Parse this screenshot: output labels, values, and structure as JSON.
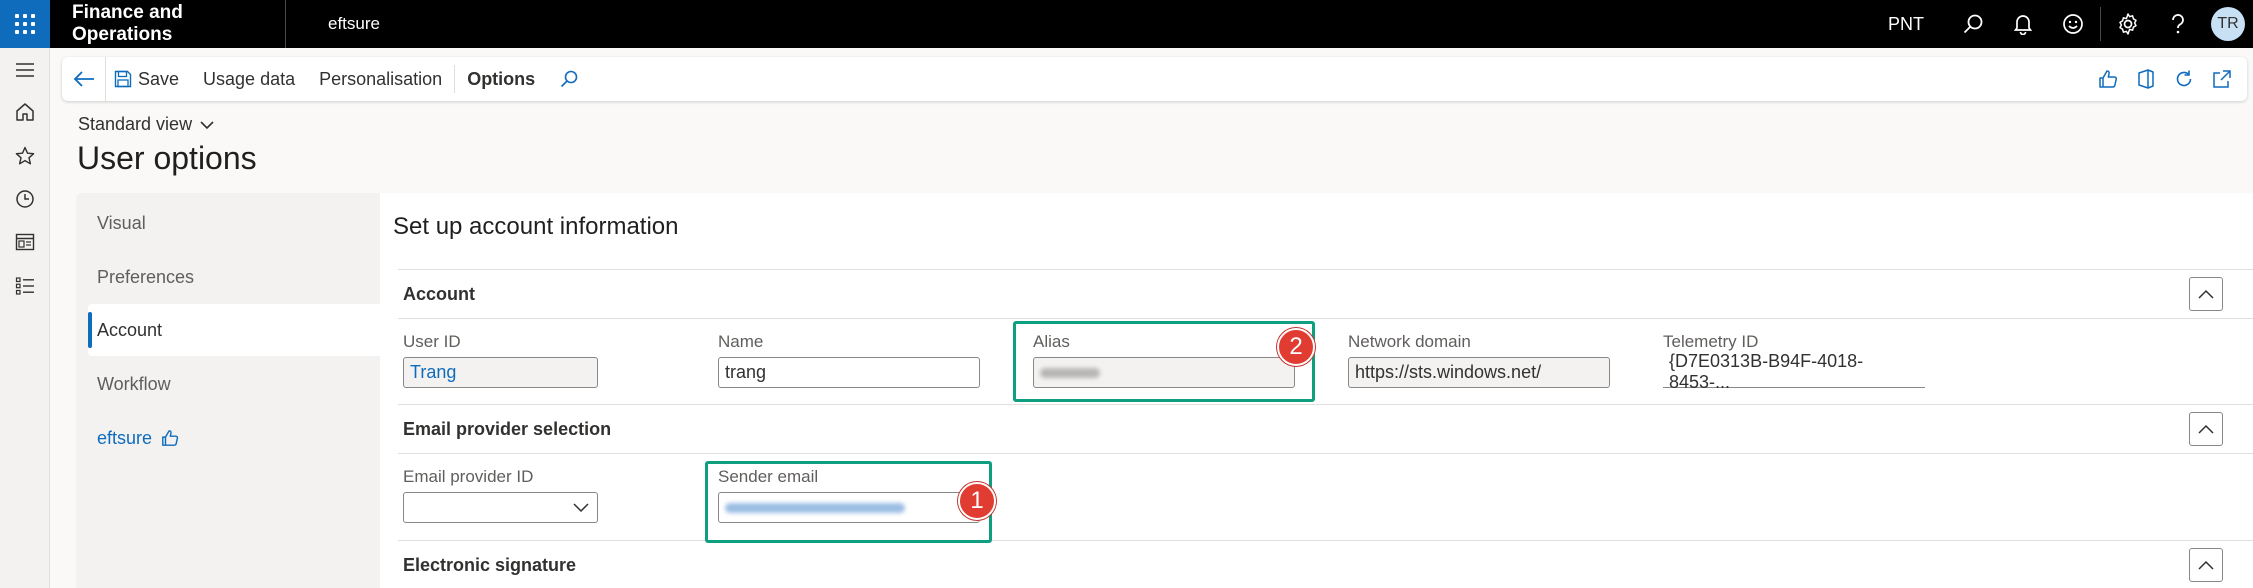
{
  "topbar": {
    "app_title": "Finance and Operations",
    "company": "eftsure",
    "legal_entity": "PNT",
    "user_initials": "TR"
  },
  "action_pane": {
    "save": "Save",
    "usage_data": "Usage data",
    "personalisation": "Personalisation",
    "options": "Options"
  },
  "header": {
    "view": "Standard view",
    "title": "User options"
  },
  "tabs": {
    "visual": "Visual",
    "preferences": "Preferences",
    "account": "Account",
    "workflow": "Workflow",
    "eftsure": "eftsure"
  },
  "content": {
    "title": "Set up account information",
    "account_section": {
      "title": "Account",
      "user_id_label": "User ID",
      "user_id_value": "Trang",
      "name_label": "Name",
      "name_value": "trang",
      "alias_label": "Alias",
      "network_domain_label": "Network domain",
      "network_domain_value": "https://sts.windows.net/",
      "telemetry_id_label": "Telemetry ID",
      "telemetry_id_value": "{D7E0313B-B94F-4018-8453-..."
    },
    "email_section": {
      "title": "Email provider selection",
      "provider_id_label": "Email provider ID",
      "sender_email_label": "Sender email"
    },
    "signature_section": {
      "title": "Electronic signature"
    }
  },
  "annotations": {
    "badge_1": "1",
    "badge_2": "2"
  },
  "colors": {
    "accent": "#0f6cbd",
    "highlight": "#0e9f80",
    "badge": "#e03c32"
  }
}
